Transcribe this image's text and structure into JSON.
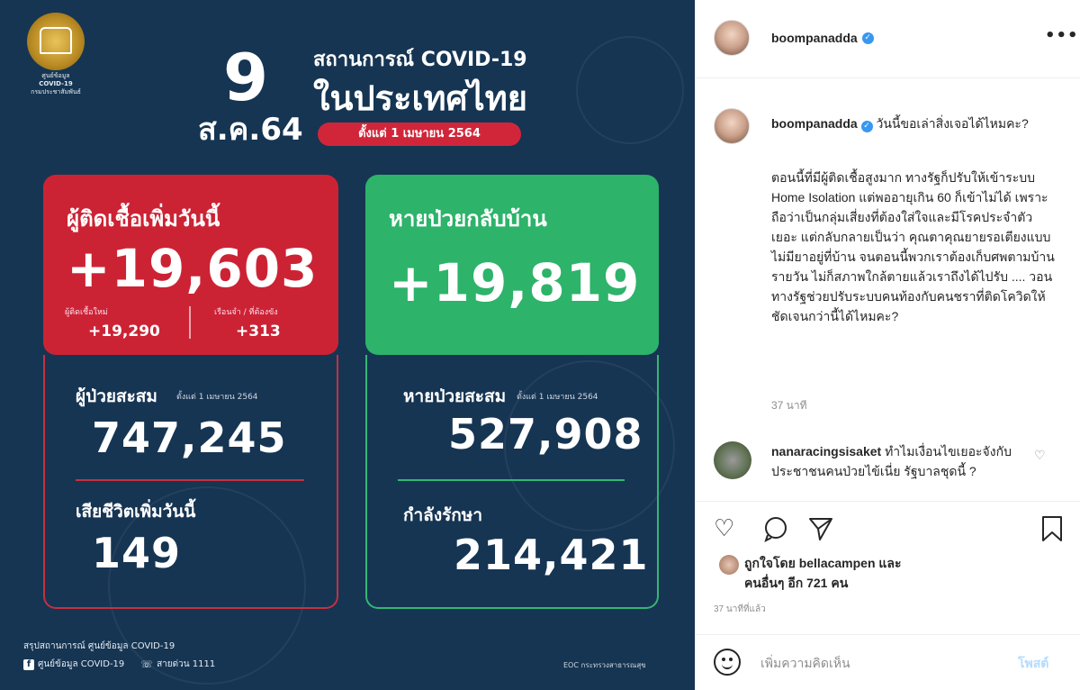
{
  "infographic": {
    "emblem_caption": [
      "ศูนย์ข้อมูล",
      "COVID-19",
      "กรมประชาสัมพันธ์"
    ],
    "day": "9",
    "month_year": "ส.ค.64",
    "title_line1": "สถานการณ์ COVID-19",
    "title_line2": "ในประเทศไทย",
    "since": "ตั้งแต่ 1 เมษายน 2564",
    "new_cases": {
      "label": "ผู้ติดเชื้อเพิ่มวันนี้",
      "value": "+19,603",
      "sub1_label": "ผู้ติดเชื้อใหม่",
      "sub1_value": "+19,290",
      "sub2_label": "เรือนจำ / ที่ต้องขัง",
      "sub2_value": "+313"
    },
    "recovered_today": {
      "label": "หายป่วยกลับบ้าน",
      "value": "+19,819"
    },
    "cumulative_cases": {
      "label": "ผู้ป่วยสะสม",
      "since": "ตั้งแต่ 1 เมษายน 2564",
      "value": "747,245"
    },
    "deaths_today": {
      "label": "เสียชีวิตเพิ่มวันนี้",
      "value": "149"
    },
    "cumulative_recovered": {
      "label": "หายป่วยสะสม",
      "since": "ตั้งแต่ 1 เมษายน 2564",
      "value": "527,908"
    },
    "in_treatment": {
      "label": "กำลังรักษา",
      "value": "214,421"
    },
    "footer_summary": "สรุปสถานการณ์ ศูนย์ข้อมูล COVID-19",
    "footer_fb": "ศูนย์ข้อมูล COVID-19",
    "footer_hotline": "สายด่วน 1111",
    "footer_source": "EOC กระทรวงสาธารณสุข"
  },
  "panel": {
    "username": "boompanadda",
    "more_label": "•••",
    "caption_intro": "วันนี้ขอเล่าสิ่งเจอได้ไหมคะ?",
    "caption_body": "ตอนนี้ที่มีผู้ติดเชื้อสูงมาก ทางรัฐก็ปรับให้เข้าระบบ Home Isolation แต่พออายุเกิน 60 ก็เข้าไม่ได้ เพราะถือว่าเป็นกลุ่มเสี่ยงที่ต้องใส่ใจและมีโรคประจำตัวเยอะ แต่กลับกลายเป็นว่า คุณตาคุณยายรอเตียงแบบไม่มียาอยู่ที่บ้าน จนตอนนี้พวกเราต้องเก็บศพตามบ้านรายวัน ไม่ก็สภาพใกล้ตายแล้วเราถึงได้ไปรับ .... วอนทางรัฐช่วยปรับระบบคนท้องกับคนชราที่ติดโควิดให้ชัดเจนกว่านี้ได้ไหมคะ?",
    "caption_time": "37 นาที",
    "comment_user": "nanaracingsisaket",
    "comment_text": "ทำไมเงื่อนไขเยอะจังกับประชาชนคนป่วยไข้เนี่ย รัฐบาลชุดนี้ ?",
    "likes_line1": "ถูกใจโดย bellacampen และ",
    "likes_line2": "คนอื่นๆ อีก 721 คน",
    "post_time": "37 นาทีที่แล้ว",
    "comment_placeholder": "เพิ่มความคิดเห็น",
    "post_button": "โพสต์"
  }
}
